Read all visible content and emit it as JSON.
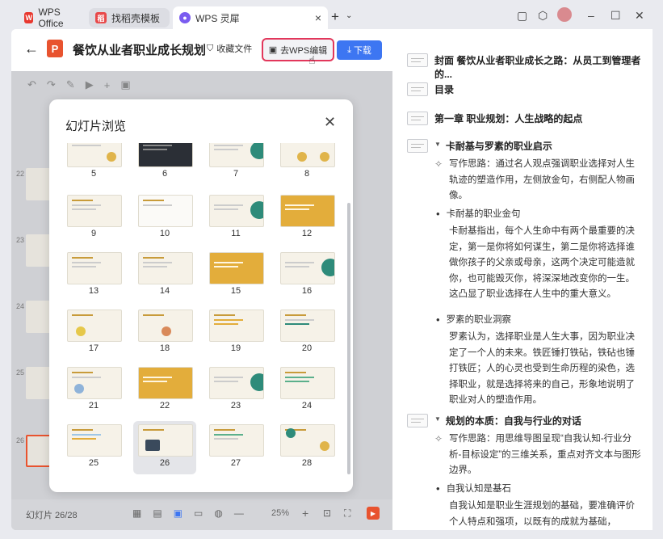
{
  "tabs": [
    {
      "label": "WPS Office",
      "icon": "wps-logo-icon"
    },
    {
      "label": "找稻壳模板",
      "icon": "docer-icon"
    },
    {
      "label": "WPS 灵犀",
      "icon": "lingxi-icon"
    }
  ],
  "header": {
    "doc_title": "餐饮从业者职业成长规划",
    "fav_label": "收藏文件",
    "edit_label": "去WPS编辑",
    "download_label": "下载"
  },
  "modal": {
    "title": "幻灯片浏览",
    "slides": [
      "5",
      "6",
      "7",
      "8",
      "9",
      "10",
      "11",
      "12",
      "13",
      "14",
      "15",
      "16",
      "17",
      "18",
      "19",
      "20",
      "21",
      "22",
      "23",
      "24",
      "25",
      "26",
      "27",
      "28"
    ],
    "selected": "26"
  },
  "left_thumbs": [
    "22",
    "23",
    "24",
    "25",
    "26"
  ],
  "status": {
    "slide_counter": "幻灯片 26/28",
    "zoom": "25%"
  },
  "outline": {
    "cover": "封面 餐饮从业者职业成长之路：从员工到管理者的...",
    "toc": "目录",
    "chapter1": "第一章 职业规划：人生战略的起点",
    "sec1": "卡耐基与罗素的职业启示",
    "sec1_note": "写作思路：通过名人观点强调职业选择对人生轨迹的塑造作用，左侧放金句，右侧配人物画像。",
    "b1": "卡耐基的职业金句",
    "b1_text": "卡耐基指出，每个人生命中有两个最重要的决定，第一是你将如何谋生，第二是你将选择谁做你孩子的父亲或母亲，这两个决定可能造就你，也可能毁灭你，将深深地改变你的一生。这凸显了职业选择在人生中的重大意义。",
    "b2": "罗素的职业洞察",
    "b2_text": "罗素认为，选择职业是人生大事，因为职业决定了一个人的未来。铁匠锤打铁砧，铁砧也锤打铁匠；人的心灵也受到生命历程的染色，选择职业，就是选择将来的自己，形象地说明了职业对人的塑造作用。",
    "sec2": "规划的本质：自我与行业的对话",
    "sec2_note": "写作思路：用思维导图呈现“自我认知-行业分析-目标设定”的三维关系，重点对齐文本与图形边界。",
    "b3": "自我认知是基石",
    "b3_text": "自我认知是职业生涯规划的基础，要准确评价个人特点和强项，以既有的成就为基础，"
  }
}
